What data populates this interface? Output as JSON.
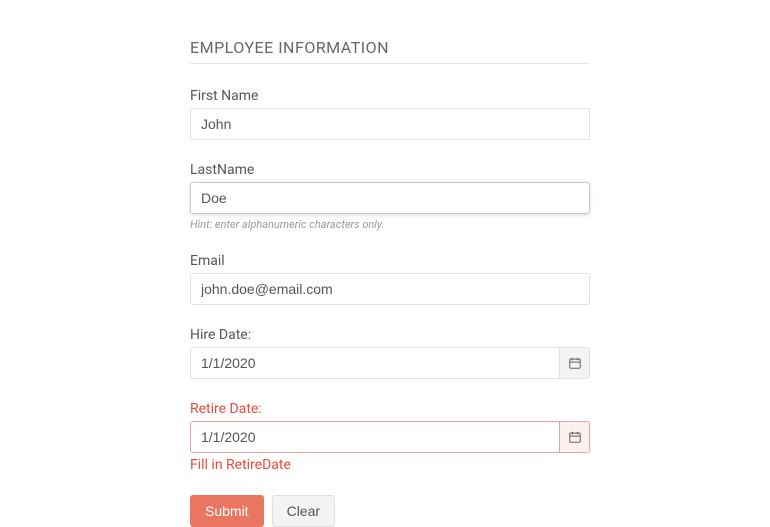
{
  "title": "EMPLOYEE INFORMATION",
  "fields": {
    "firstName": {
      "label": "First Name",
      "value": "John"
    },
    "lastName": {
      "label": "LastName",
      "value": "Doe",
      "hint": "Hint: enter alphanumeric characters only."
    },
    "email": {
      "label": "Email",
      "value": "john.doe@email.com"
    },
    "hireDate": {
      "label": "Hire Date:",
      "value": "1/1/2020"
    },
    "retireDate": {
      "label": "Retire Date:",
      "value": "1/1/2020",
      "error": "Fill in RetireDate"
    }
  },
  "buttons": {
    "submit": "Submit",
    "clear": "Clear"
  },
  "icons": {
    "calendar": "calendar-icon"
  }
}
